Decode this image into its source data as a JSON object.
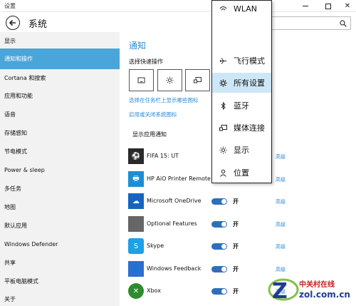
{
  "window": {
    "title": "设置"
  },
  "header": {
    "title": "系统"
  },
  "sidebar": {
    "items": [
      {
        "label": "显示"
      },
      {
        "label": "通知和操作"
      },
      {
        "label": "Cortana 和搜索"
      },
      {
        "label": "应用和功能"
      },
      {
        "label": "语音"
      },
      {
        "label": "存储感知"
      },
      {
        "label": "节电模式"
      },
      {
        "label": "Power & sleep"
      },
      {
        "label": "多任务"
      },
      {
        "label": "地图"
      },
      {
        "label": "默认应用"
      },
      {
        "label": "Windows Defender"
      },
      {
        "label": "共享"
      },
      {
        "label": "平板电脑模式"
      },
      {
        "label": "关于"
      }
    ],
    "active_index": 1
  },
  "main": {
    "section_title": "通知",
    "quick_actions_label": "选择快速操作",
    "link_taskbar_icons": "选择在任务栏上显示哪些图标",
    "link_system_icons": "启用或关闭系统图标",
    "show_app_notifications_label": "显示应用通知",
    "apps": [
      {
        "name": "FIFA 15: UT",
        "toggle": "",
        "advanced": "高级",
        "icon_color": "#2a2a2a"
      },
      {
        "name": "HP AiO Printer Remote",
        "toggle": "",
        "advanced": "高级",
        "icon_color": "#1a8fd6"
      },
      {
        "name": "Microsoft OneDrive",
        "toggle": "开",
        "advanced": "高级",
        "icon_color": "#1565c0"
      },
      {
        "name": "Optional Features",
        "toggle": "开",
        "advanced": "高级",
        "icon_color": "#666666"
      },
      {
        "name": "Skype",
        "toggle": "开",
        "advanced": "高级",
        "icon_color": "#1ca0e8"
      },
      {
        "name": "Windows Feedback",
        "toggle": "开",
        "advanced": "高级",
        "icon_color": "#2b6fd1"
      },
      {
        "name": "Xbox",
        "toggle": "开",
        "advanced": "高级",
        "icon_color": "#2e8b2e"
      }
    ]
  },
  "popup": {
    "items": [
      {
        "label": "WLAN",
        "icon": "wifi-icon"
      },
      {
        "label": "飞行模式",
        "icon": "airplane-icon"
      },
      {
        "label": "所有设置",
        "icon": "gear-icon"
      },
      {
        "label": "蓝牙",
        "icon": "bluetooth-icon"
      },
      {
        "label": "媒体连接",
        "icon": "connect-icon"
      },
      {
        "label": "显示",
        "icon": "brightness-icon"
      },
      {
        "label": "位置",
        "icon": "location-icon"
      }
    ],
    "highlighted_index": 2
  },
  "watermark": {
    "cn": "中关村在线",
    "en": "zol.com.cn"
  },
  "colors": {
    "accent": "#4aa5d8",
    "link": "#2b8ad6",
    "toggle_on": "#2e6fba",
    "highlight": "#cde7f7"
  }
}
